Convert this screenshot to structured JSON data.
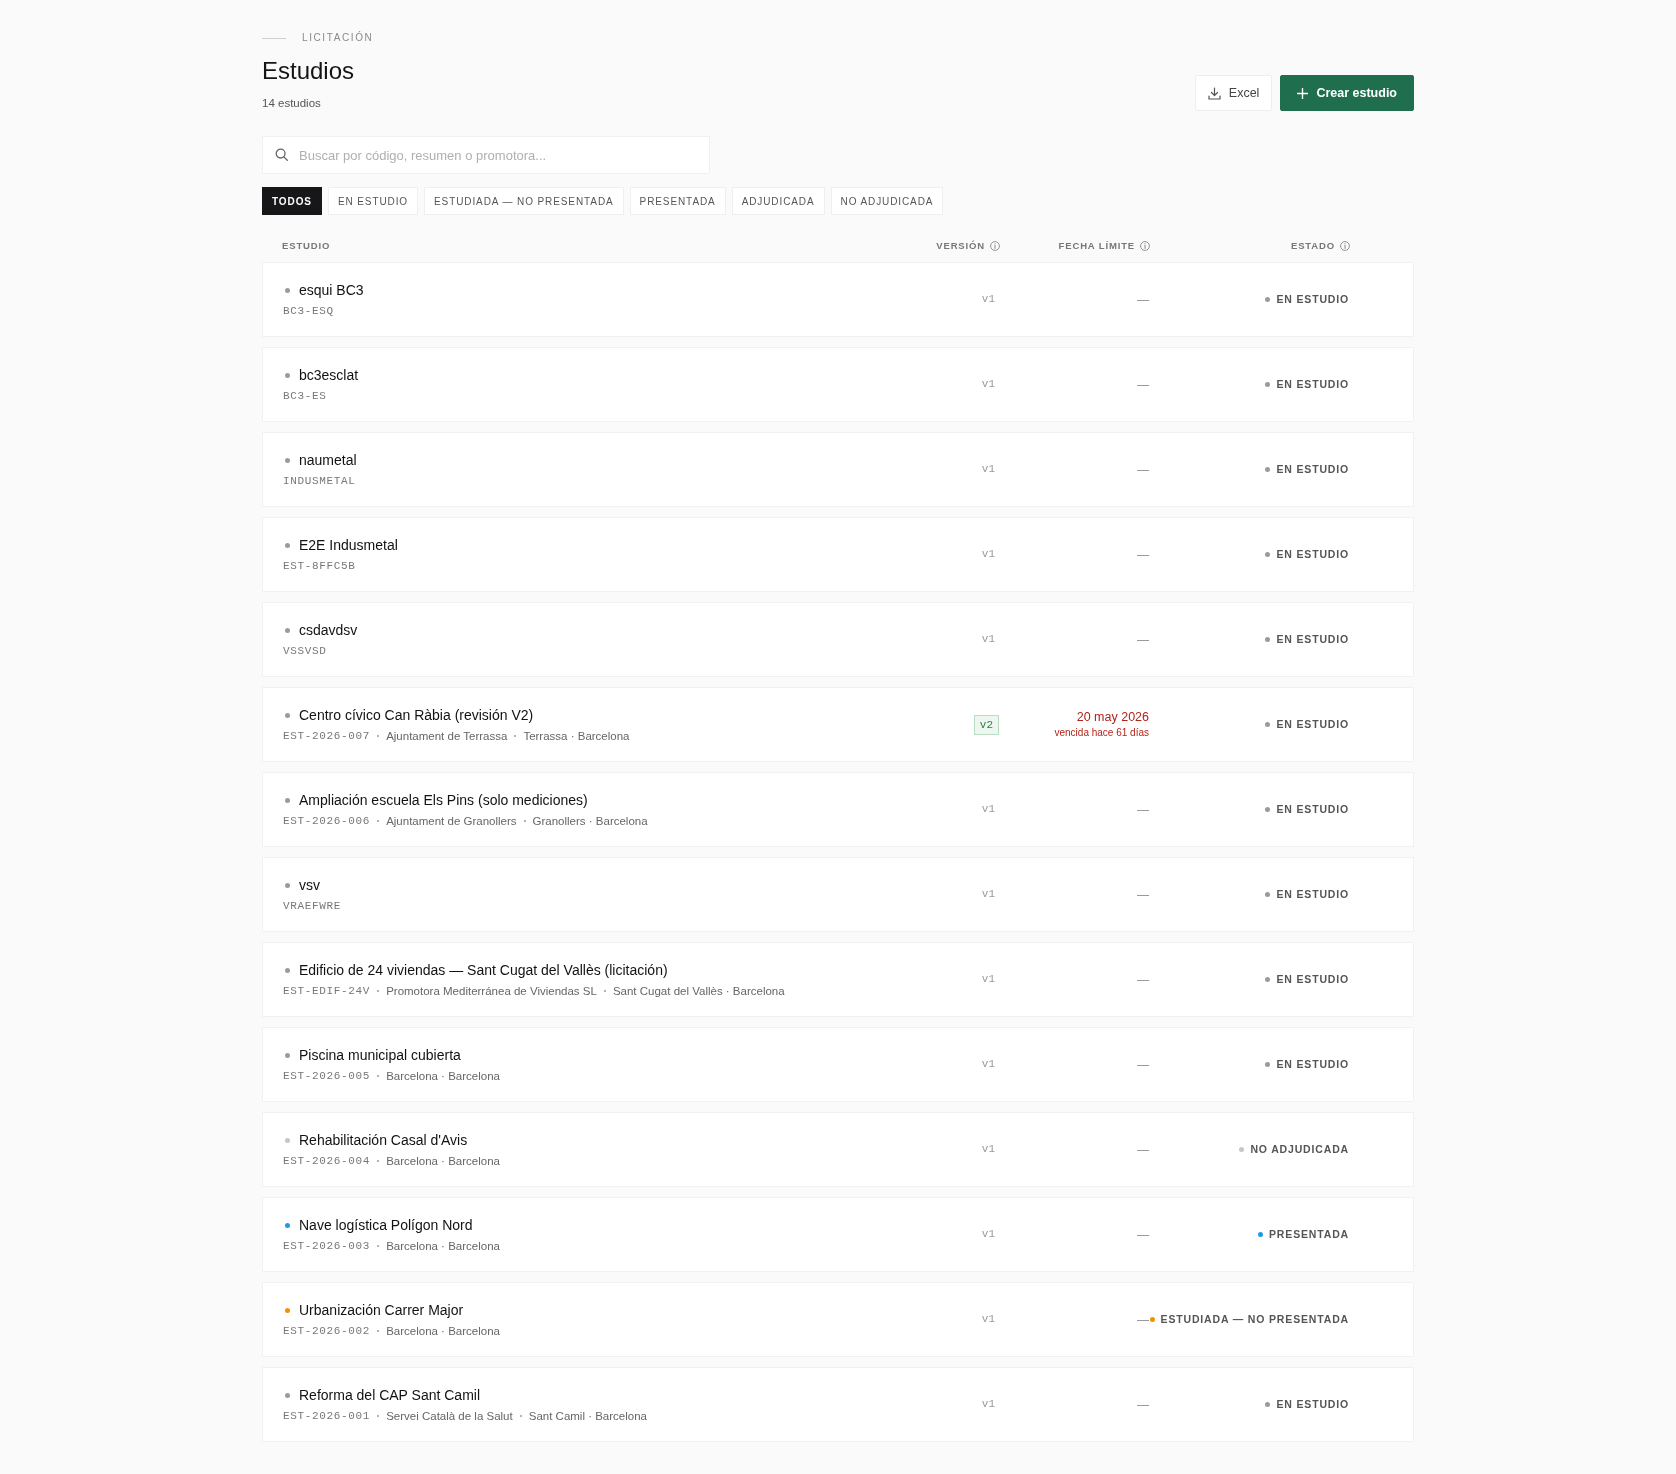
{
  "breadcrumb": "LICITACIÓN",
  "title": "Estudios",
  "count": "14 estudios",
  "actions": [
    {
      "label": "Excel",
      "kind": "export"
    },
    {
      "label": "Crear estudio",
      "kind": "create"
    }
  ],
  "search": {
    "placeholder": "Buscar por código, resumen o promotora..."
  },
  "filters": [
    {
      "label": "TODOS",
      "selected": true
    },
    {
      "label": "EN ESTUDIO",
      "selected": false
    },
    {
      "label": "ESTUDIADA — NO PRESENTADA",
      "selected": false
    },
    {
      "label": "PRESENTADA",
      "selected": false
    },
    {
      "label": "ADJUDICADA",
      "selected": false
    },
    {
      "label": "NO ADJUDICADA",
      "selected": false
    }
  ],
  "table": {
    "columns": [
      {
        "label": "ESTUDIO",
        "info": false
      },
      {
        "label": "VERSIÓN",
        "info": true
      },
      {
        "label": "FECHA LÍMITE",
        "info": true
      },
      {
        "label": "ESTADO",
        "info": true
      }
    ],
    "rows": [
      {
        "name": "esqui BC3",
        "code": "BC3-ESQ",
        "version": "v1",
        "highlighted": false,
        "deadline": "—",
        "overdue": false,
        "status": "EN ESTUDIO",
        "color": "#9b9b9b"
      },
      {
        "name": "bc3esclat",
        "code": "BC3-ES",
        "version": "v1",
        "highlighted": false,
        "deadline": "—",
        "overdue": false,
        "status": "EN ESTUDIO",
        "color": "#9b9b9b"
      },
      {
        "name": "naumetal",
        "code": "INDUSMETAL",
        "version": "v1",
        "highlighted": false,
        "deadline": "—",
        "overdue": false,
        "status": "EN ESTUDIO",
        "color": "#9b9b9b"
      },
      {
        "name": "E2E Indusmetal",
        "code": "EST-8FFC5B",
        "version": "v1",
        "highlighted": false,
        "deadline": "—",
        "overdue": false,
        "status": "EN ESTUDIO",
        "color": "#9b9b9b"
      },
      {
        "name": "csdavdsv",
        "code": "VSSVSD",
        "version": "v1",
        "highlighted": false,
        "deadline": "—",
        "overdue": false,
        "status": "EN ESTUDIO",
        "color": "#9b9b9b"
      },
      {
        "name": "Centro cívico Can Ràbia (revisión V2)",
        "code": "EST-2026-007",
        "details": [
          "Ajuntament de Terrassa",
          "Terrassa · Barcelona"
        ],
        "version": "v2",
        "highlighted": true,
        "deadline": "20 may 2026",
        "deadline_note": "vencida hace 61 días",
        "overdue": true,
        "status": "EN ESTUDIO",
        "color": "#9b9b9b"
      },
      {
        "name": "Ampliación escuela Els Pins (solo mediciones)",
        "code": "EST-2026-006",
        "details": [
          "Ajuntament de Granollers",
          "Granollers · Barcelona"
        ],
        "version": "v1",
        "highlighted": false,
        "deadline": "—",
        "overdue": false,
        "status": "EN ESTUDIO",
        "color": "#9b9b9b"
      },
      {
        "name": "vsv",
        "code": "VRAEFWRE",
        "version": "v1",
        "highlighted": false,
        "deadline": "—",
        "overdue": false,
        "status": "EN ESTUDIO",
        "color": "#9b9b9b"
      },
      {
        "name": "Edificio de 24 viviendas — Sant Cugat del Vallès (licitación)",
        "code": "EST-EDIF-24V",
        "details": [
          "Promotora Mediterránea de Viviendas SL",
          "Sant Cugat del Vallès · Barcelona"
        ],
        "version": "v1",
        "highlighted": false,
        "deadline": "—",
        "overdue": false,
        "status": "EN ESTUDIO",
        "color": "#9b9b9b"
      },
      {
        "name": "Piscina municipal cubierta",
        "code": "EST-2026-005",
        "details": [
          "Barcelona · Barcelona"
        ],
        "version": "v1",
        "highlighted": false,
        "deadline": "—",
        "overdue": false,
        "status": "EN ESTUDIO",
        "color": "#9b9b9b"
      },
      {
        "name": "Rehabilitación Casal d'Avis",
        "code": "EST-2026-004",
        "details": [
          "Barcelona · Barcelona"
        ],
        "version": "v1",
        "highlighted": false,
        "deadline": "—",
        "overdue": false,
        "status": "NO ADJUDICADA",
        "color": "#c6c6c6"
      },
      {
        "name": "Nave logística Polígon Nord",
        "code": "EST-2026-003",
        "details": [
          "Barcelona · Barcelona"
        ],
        "version": "v1",
        "highlighted": false,
        "deadline": "—",
        "overdue": false,
        "status": "PRESENTADA",
        "color": "#1a9be6"
      },
      {
        "name": "Urbanización Carrer Major",
        "code": "EST-2026-002",
        "details": [
          "Barcelona · Barcelona"
        ],
        "version": "v1",
        "highlighted": false,
        "deadline": "—",
        "overdue": false,
        "status": "ESTUDIADA — NO PRESENTADA",
        "color": "#f39200"
      },
      {
        "name": "Reforma del CAP Sant Camil",
        "code": "EST-2026-001",
        "details": [
          "Servei Català de la Salut",
          "Sant Camil · Barcelona"
        ],
        "version": "v1",
        "highlighted": false,
        "deadline": "—",
        "overdue": false,
        "status": "EN ESTUDIO",
        "color": "#9b9b9b"
      }
    ]
  }
}
